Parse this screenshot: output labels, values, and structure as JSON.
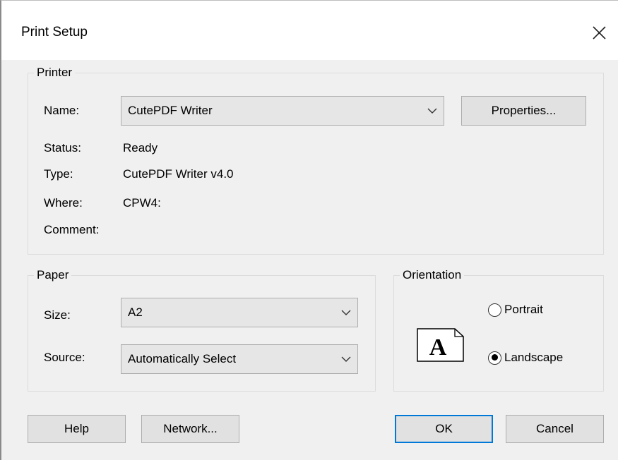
{
  "dialog": {
    "title": "Print Setup"
  },
  "printer": {
    "group_label": "Printer",
    "name_label": "Name:",
    "name_value": "CutePDF Writer",
    "properties_label": "Properties...",
    "status_label": "Status:",
    "status_value": "Ready",
    "type_label": "Type:",
    "type_value": "CutePDF Writer v4.0",
    "where_label": "Where:",
    "where_value": "CPW4:",
    "comment_label": "Comment:",
    "comment_value": ""
  },
  "paper": {
    "group_label": "Paper",
    "size_label": "Size:",
    "size_value": "A2",
    "source_label": "Source:",
    "source_value": "Automatically Select"
  },
  "orientation": {
    "group_label": "Orientation",
    "portrait_label": "Portrait",
    "landscape_label": "Landscape",
    "selected": "Landscape",
    "preview_letter": "A"
  },
  "buttons": {
    "help": "Help",
    "network": "Network...",
    "ok": "OK",
    "cancel": "Cancel"
  },
  "icons": {
    "close": "close-icon",
    "dropdown": "chevron-down-icon",
    "page_preview": "landscape-page-icon"
  }
}
